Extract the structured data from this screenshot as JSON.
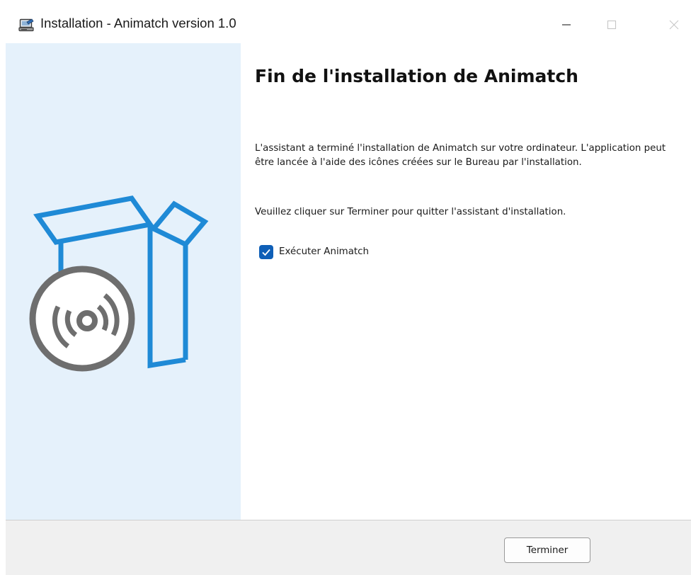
{
  "window": {
    "title": "Installation - Animatch version 1.0",
    "controls": [
      "minimize-icon",
      "maximize-icon",
      "close-icon"
    ]
  },
  "banner": {
    "illustration": "software-box-with-disc",
    "background_color": "#e5f1fb",
    "accent_color": "#1f8ad6",
    "disc_color": "#6e6e6e"
  },
  "content": {
    "heading": "Fin de l'installation de Animatch",
    "paragraph1": "L'assistant a terminé l'installation de Animatch sur votre ordinateur. L'application peut être lancée à l'aide des icônes créées sur le Bureau par l'installation.",
    "paragraph2": "Veuillez cliquer sur Terminer pour quitter l'assistant d'installation.",
    "run_checkbox": {
      "label": "Exécuter Animatch",
      "checked": true,
      "color": "#0f5fb7"
    }
  },
  "footer": {
    "finish_label": "Terminer"
  }
}
